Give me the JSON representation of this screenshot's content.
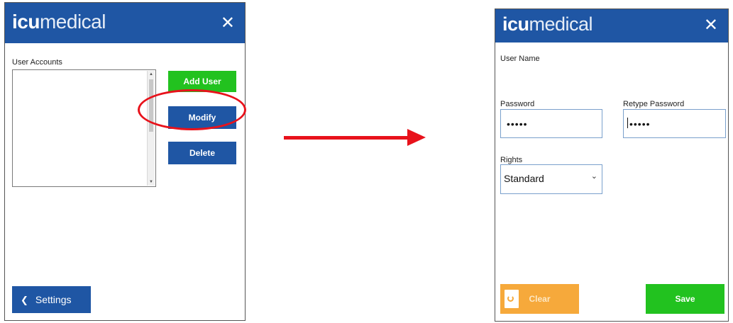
{
  "brand": {
    "bold": "icu",
    "light": "medical"
  },
  "close_glyph": "✕",
  "left_window": {
    "user_accounts_label": "User Accounts",
    "buttons": {
      "add_user": "Add User",
      "modify": "Modify",
      "delete": "Delete"
    },
    "back_glyph": "❮",
    "settings_label": "Settings"
  },
  "arrow_glyph_none": "",
  "right_window": {
    "user_name_label": "User Name",
    "password_label": "Password",
    "password_value": "•••••",
    "retype_password_label": "Retype Password",
    "retype_password_value": "•••••",
    "rights_label": "Rights",
    "rights_value": "Standard",
    "dropdown_glyph": "⌄",
    "clear_label": "Clear",
    "save_label": "Save"
  },
  "colors": {
    "brand_blue": "#1f56a4",
    "green": "#22c21f",
    "orange": "#f6a93b",
    "annotation_red": "#e8121b"
  }
}
